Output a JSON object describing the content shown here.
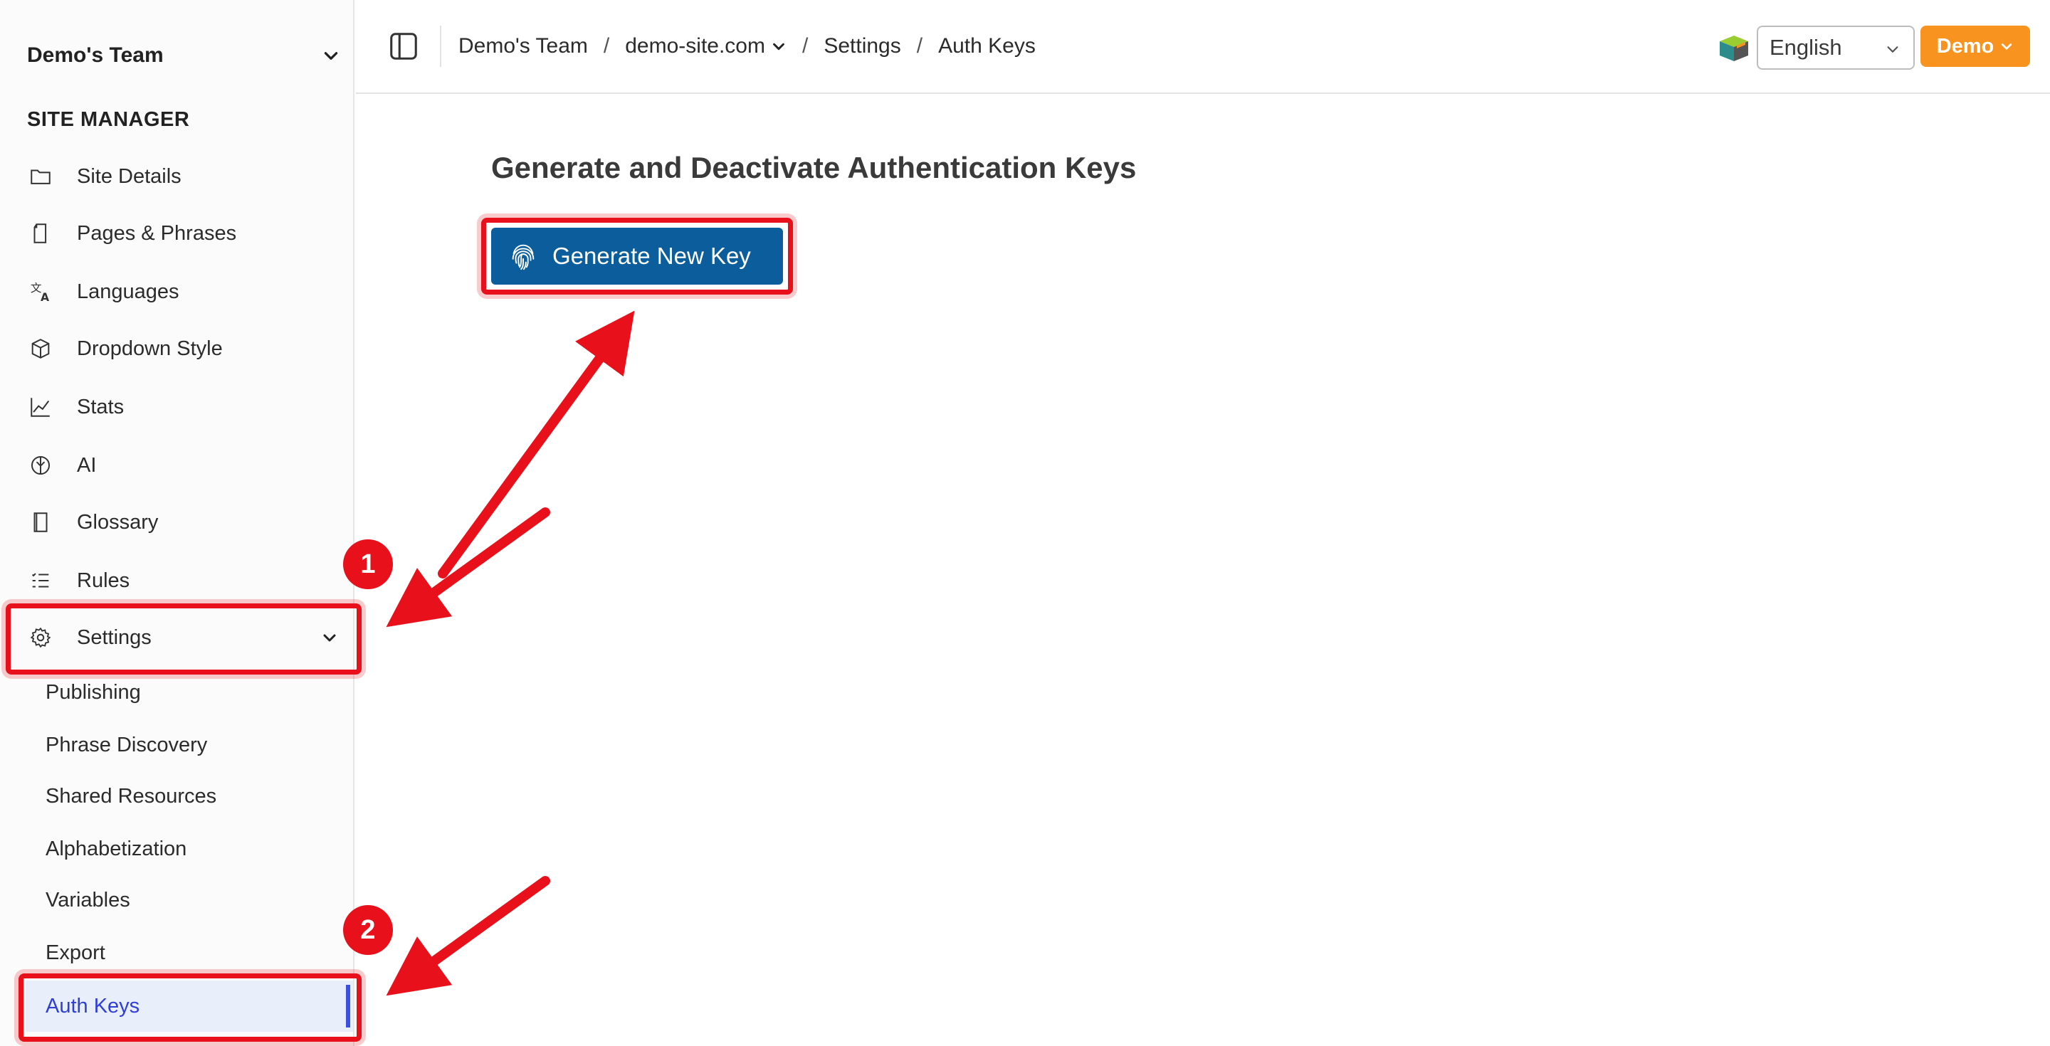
{
  "sidebar": {
    "team_name": "Demo's Team",
    "section_title": "SITE MANAGER",
    "items": [
      {
        "label": "Site Details",
        "icon": "folder-icon"
      },
      {
        "label": "Pages & Phrases",
        "icon": "page-icon"
      },
      {
        "label": "Languages",
        "icon": "translate-icon"
      },
      {
        "label": "Dropdown Style",
        "icon": "cube-icon"
      },
      {
        "label": "Stats",
        "icon": "chart-line-icon"
      },
      {
        "label": "AI",
        "icon": "brain-icon"
      },
      {
        "label": "Glossary",
        "icon": "book-icon"
      },
      {
        "label": "Rules",
        "icon": "list-check-icon"
      },
      {
        "label": "Settings",
        "icon": "gear-icon"
      }
    ],
    "settings_sub": [
      {
        "label": "Publishing"
      },
      {
        "label": "Phrase Discovery"
      },
      {
        "label": "Shared Resources"
      },
      {
        "label": "Alphabetization"
      },
      {
        "label": "Variables"
      },
      {
        "label": "Export"
      },
      {
        "label": "Auth Keys",
        "active": true
      }
    ]
  },
  "header": {
    "breadcrumb": [
      "Demo's Team",
      "demo-site.com",
      "Settings",
      "Auth Keys"
    ],
    "language": "English",
    "account_button": "Demo"
  },
  "main": {
    "title": "Generate and Deactivate Authentication Keys",
    "generate_button": "Generate New Key"
  },
  "annotations": {
    "badge_1": "1",
    "badge_2": "2",
    "color": "#e8111b"
  },
  "colors": {
    "primary_button": "#0b5e9b",
    "account_button": "#f7931e",
    "active_nav": "#2f3fd6"
  }
}
